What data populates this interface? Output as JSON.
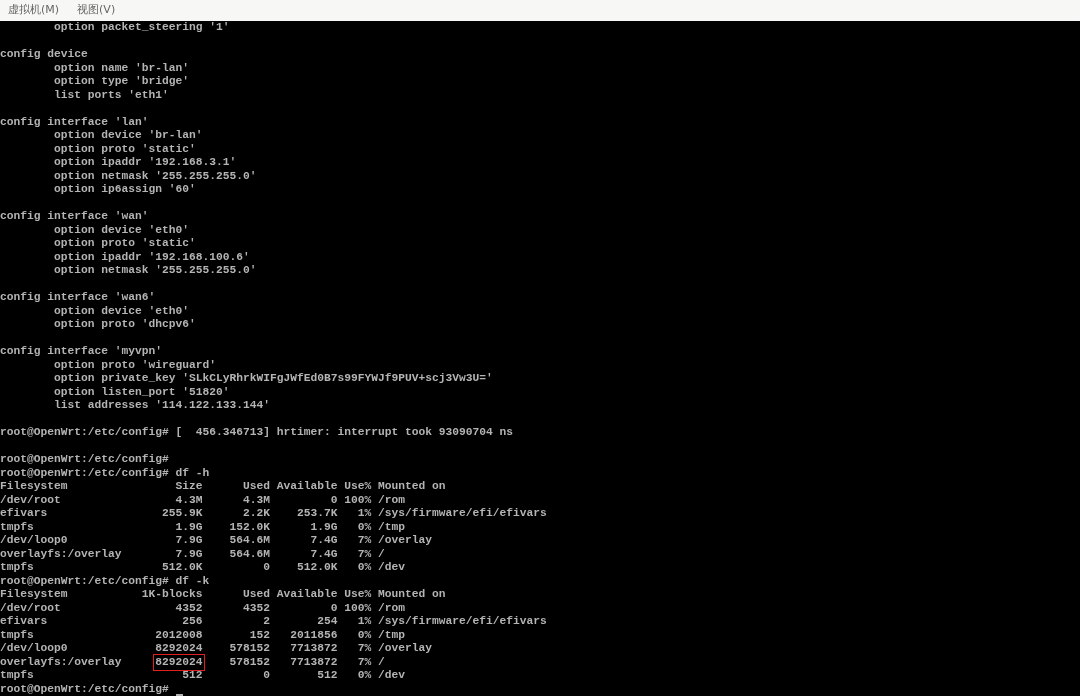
{
  "menu_bar": {
    "items": [
      "虚拟机(M)",
      "视图(V)"
    ]
  },
  "terminal": {
    "blocks": [
      [
        "        option packet_steering '1'"
      ],
      [
        "config device",
        "        option name 'br-lan'",
        "        option type 'bridge'",
        "        list ports 'eth1'"
      ],
      [
        "config interface 'lan'",
        "        option device 'br-lan'",
        "        option proto 'static'",
        "        option ipaddr '192.168.3.1'",
        "        option netmask '255.255.255.0'",
        "        option ip6assign '60'"
      ],
      [
        "config interface 'wan'",
        "        option device 'eth0'",
        "        option proto 'static'",
        "        option ipaddr '192.168.100.6'",
        "        option netmask '255.255.255.0'"
      ],
      [
        "config interface 'wan6'",
        "        option device 'eth0'",
        "        option proto 'dhcpv6'"
      ],
      [
        "config interface 'myvpn'",
        "        option proto 'wireguard'",
        "        option private_key 'SLkCLyRhrkWIFgJWfEd0B7s99FYWJf9PUV+scj3Vw3U='",
        "        option listen_port '51820'",
        "        list addresses '114.122.133.144'"
      ],
      [
        "root@OpenWrt:/etc/config# [  456.346713] hrtimer: interrupt took 93090704 ns"
      ],
      [
        "root@OpenWrt:/etc/config#",
        "root@OpenWrt:/etc/config# df -h",
        "Filesystem                Size      Used Available Use% Mounted on",
        "/dev/root                 4.3M      4.3M         0 100% /rom",
        "efivars                 255.9K      2.2K    253.7K   1% /sys/firmware/efi/efivars",
        "tmpfs                     1.9G    152.0K      1.9G   0% /tmp",
        "/dev/loop0                7.9G    564.6M      7.4G   7% /overlay",
        "overlayfs:/overlay        7.9G    564.6M      7.4G   7% /",
        "tmpfs                   512.0K         0    512.0K   0% /dev",
        "root@OpenWrt:/etc/config# df -k",
        "Filesystem           1K-blocks      Used Available Use% Mounted on",
        "/dev/root                 4352      4352         0 100% /rom",
        "efivars                    256         2       254   1% /sys/firmware/efi/efivars",
        "tmpfs                  2012008       152   2011856   0% /tmp",
        "/dev/loop0             8292024    578152   7713872   7% /overlay",
        {
          "segments": [
            {
              "text": "overlayfs:/overlay     ",
              "highlighted": false
            },
            {
              "text": "8292024",
              "highlighted": true
            },
            {
              "text": "    578152   7713872   7% /",
              "highlighted": false
            }
          ]
        },
        "tmpfs                      512         0       512   0% /dev",
        {
          "segments": [
            {
              "text": "root@OpenWrt:/etc/config# "
            }
          ],
          "cursor": true
        }
      ]
    ]
  }
}
